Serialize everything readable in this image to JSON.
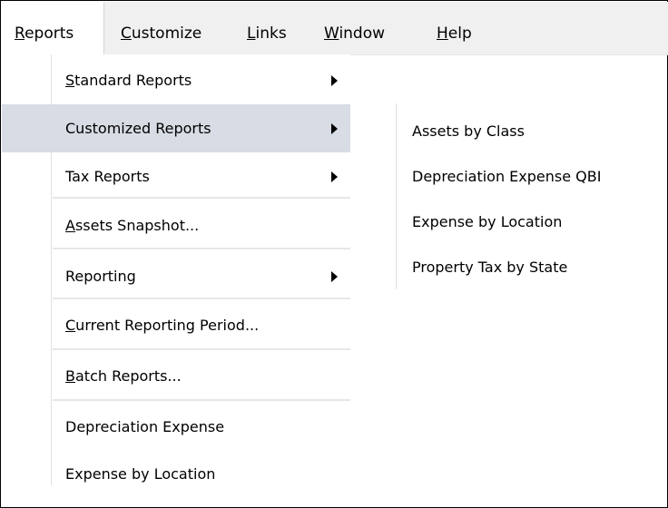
{
  "menubar": {
    "items": [
      {
        "prefix": "",
        "mnemonic": "R",
        "suffix": "eports"
      },
      {
        "prefix": "",
        "mnemonic": "C",
        "suffix": "ustomize"
      },
      {
        "prefix": "",
        "mnemonic": "L",
        "suffix": "inks"
      },
      {
        "prefix": "",
        "mnemonic": "W",
        "suffix": "indow"
      },
      {
        "prefix": "",
        "mnemonic": "H",
        "suffix": "elp"
      }
    ]
  },
  "reports_menu": {
    "items": [
      {
        "prefix": "",
        "mnemonic": "S",
        "suffix": "tandard Reports"
      },
      {
        "prefix": "",
        "mnemonic": "",
        "suffix": "Customized Reports"
      },
      {
        "prefix": "",
        "mnemonic": "",
        "suffix": "Tax Reports"
      },
      {
        "prefix": "",
        "mnemonic": "A",
        "suffix": "ssets Snapshot..."
      },
      {
        "prefix": "",
        "mnemonic": "",
        "suffix": "Reporting"
      },
      {
        "prefix": "",
        "mnemonic": "C",
        "suffix": "urrent Reporting Period..."
      },
      {
        "prefix": "",
        "mnemonic": "B",
        "suffix": "atch Reports..."
      },
      {
        "prefix": "",
        "mnemonic": "",
        "suffix": "Depreciation Expense"
      },
      {
        "prefix": "",
        "mnemonic": "",
        "suffix": "Expense by Location"
      }
    ],
    "highlighted_index": 1
  },
  "customized_reports_submenu": {
    "items": [
      "Assets by Class",
      "Depreciation Expense QBI",
      "Expense by Location",
      "Property Tax by State"
    ]
  },
  "colors": {
    "menubar_bg": "#f0f0f0",
    "highlight_bg": "#d8dce4",
    "separator": "#e6e6e6"
  },
  "icons": {
    "submenu_arrow": "triangle-right-icon"
  }
}
